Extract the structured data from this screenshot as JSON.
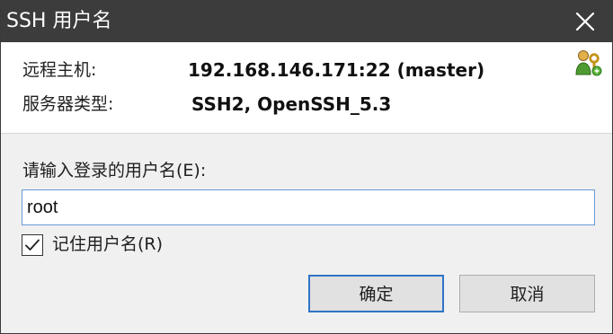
{
  "window": {
    "title": "SSH 用户名"
  },
  "info": {
    "remote_host_label": "远程主机:",
    "remote_host_value": "192.168.146.171:22 (master)",
    "server_type_label": "服务器类型:",
    "server_type_value": "SSH2, OpenSSH_5.3",
    "icon": "user-key-icon"
  },
  "form": {
    "username_prompt": "请输入登录的用户名(E):",
    "username_value": "root",
    "remember_label": "记住用户名(R)",
    "remember_checked": true
  },
  "buttons": {
    "ok_label": "确定",
    "cancel_label": "取消"
  },
  "colors": {
    "titlebar_bg": "#3c3c3c",
    "accent_blue": "#2f74c6",
    "input_border": "#6a99d8",
    "icon_green": "#5ba533",
    "icon_gold": "#d3a72c"
  }
}
